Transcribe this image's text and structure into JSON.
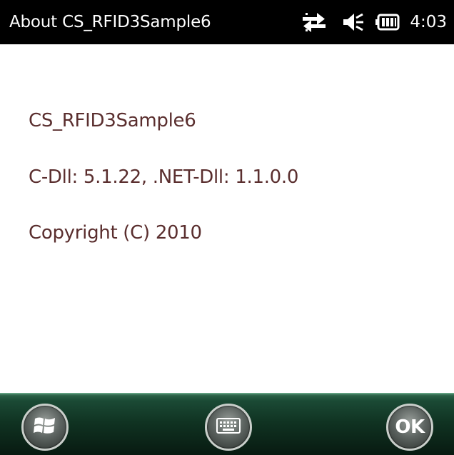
{
  "status_bar": {
    "title": "About CS_RFID3Sample6",
    "time": "4:03",
    "icons": [
      "connectivity-icon",
      "speaker-icon",
      "battery-icon"
    ]
  },
  "about": {
    "app_name": "CS_RFID3Sample6",
    "versions": "C-Dll: 5.1.22, .NET-Dll: 1.1.0.0",
    "copyright": "Copyright (C) 2010"
  },
  "softkeys": {
    "left_icon": "windows-start-icon",
    "center_icon": "keyboard-icon",
    "right_label": "OK"
  },
  "colors": {
    "status_bar_bg": "#000000",
    "text": "#5a2e2e",
    "softkey_bar": "#1b4a35"
  }
}
